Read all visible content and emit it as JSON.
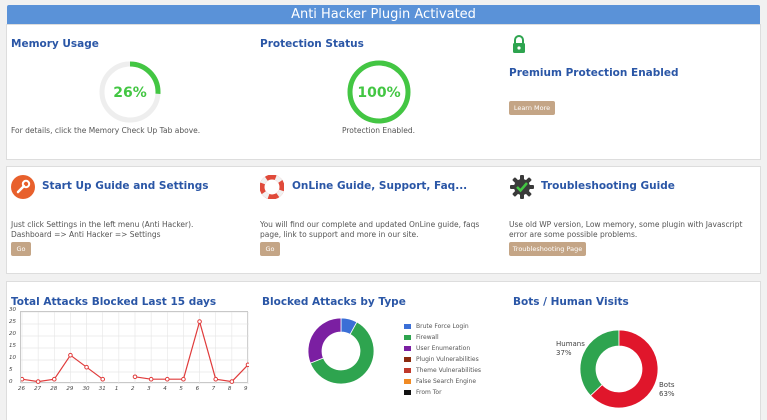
{
  "banner": {
    "title": "Anti Hacker Plugin Activated"
  },
  "memory": {
    "title": "Memory Usage",
    "value": "26%",
    "percent": 26,
    "note": "For details, click the Memory Check Up Tab above."
  },
  "protection": {
    "title": "Protection Status",
    "value": "100%",
    "percent": 100,
    "note": "Protection Enabled."
  },
  "premium": {
    "title": "Premium Protection Enabled",
    "button": "Learn More",
    "icon": "padlock-icon"
  },
  "guides": [
    {
      "title": "Start Up Guide and Settings",
      "text": "Just click Settings in the left menu (Anti Hacker). Dashboard => Anti Hacker => Settings",
      "button": "Go",
      "icon": "wrench-icon"
    },
    {
      "title": "OnLine Guide, Support, Faq...",
      "text": "You will find our complete and updated OnLine guide, faqs page, link to support and more in our site.",
      "button": "Go",
      "icon": "lifebuoy-icon"
    },
    {
      "title": "Troubleshooting Guide",
      "text": "Use old WP version, Low memory, some plugin with Javascript error are some possible problems.",
      "button": "Troubleshooting Page",
      "icon": "gear-icon"
    }
  ],
  "chart_data": [
    {
      "type": "line",
      "title": "Total Attacks Blocked Last 15 days",
      "x": [
        "26",
        "27",
        "28",
        "29",
        "30",
        "31",
        "1",
        "2",
        "3",
        "4",
        "5",
        "6",
        "7",
        "8",
        "9"
      ],
      "values": [
        2,
        1,
        2,
        12,
        7,
        2,
        null,
        3,
        2,
        2,
        2,
        26,
        2,
        1,
        8
      ],
      "ylim": [
        0,
        30
      ],
      "yticks": [
        0,
        5,
        10,
        15,
        20,
        25,
        30
      ],
      "color": "#e03b3b",
      "grid": true
    },
    {
      "type": "pie",
      "title": "Blocked Attacks by Type",
      "labels": [
        "Brute Force Login",
        "Firewall",
        "User Enumeration",
        "Plugin Vulnerabilities",
        "Theme Vulnerabilities",
        "False Search Engine",
        "From Tor"
      ],
      "colors": [
        "#3b6fd6",
        "#2ea44f",
        "#7b1fa2",
        "#8b2a0f",
        "#c0392b",
        "#f08a24",
        "#111111"
      ],
      "values": [
        8,
        61,
        31,
        0,
        0,
        0,
        0
      ]
    },
    {
      "type": "pie",
      "title": "Bots / Human Visits",
      "labels": [
        "Humans",
        "Bots"
      ],
      "percent_labels": [
        "37%",
        "63%"
      ],
      "colors": [
        "#2ea44f",
        "#e0162b"
      ],
      "values": [
        37,
        63
      ]
    }
  ]
}
